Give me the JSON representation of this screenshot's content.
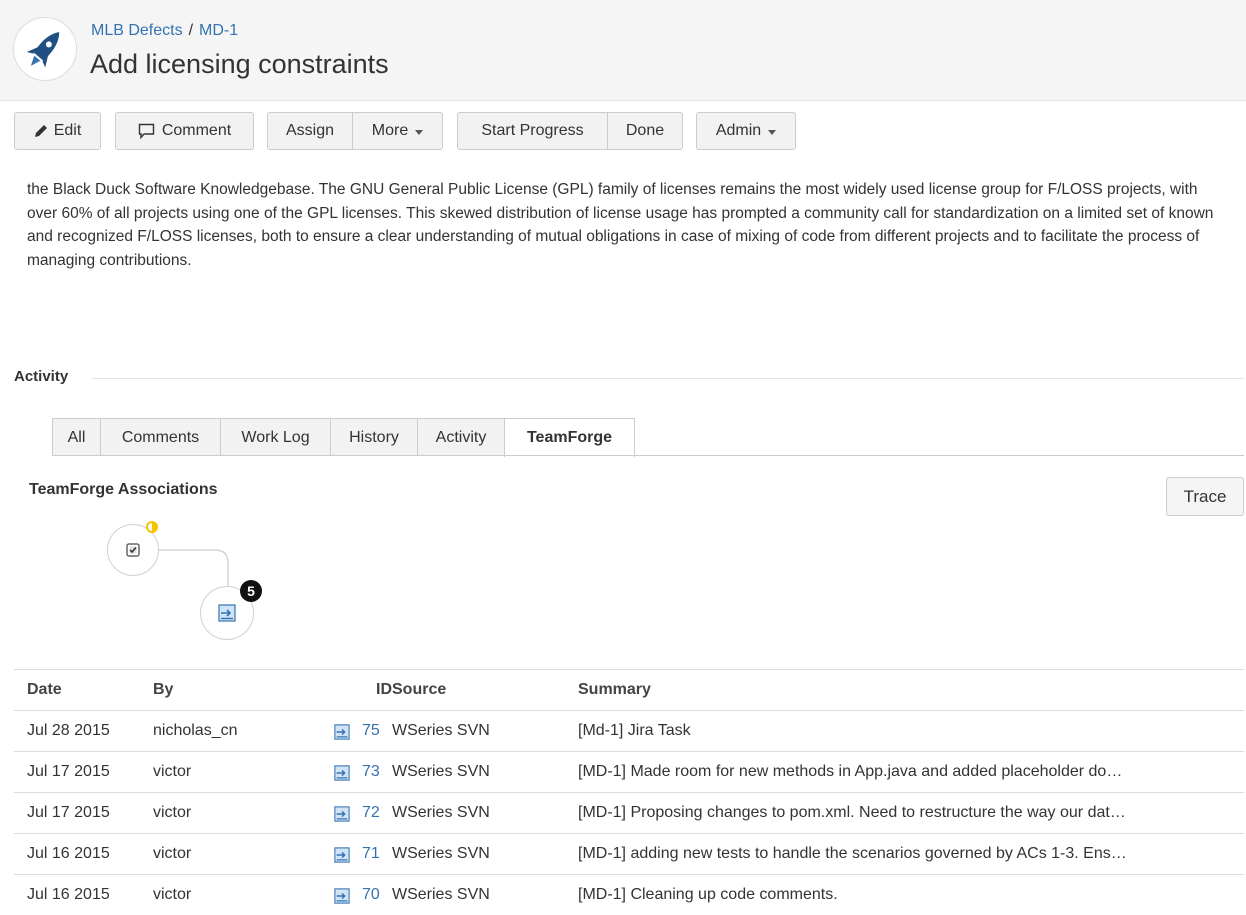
{
  "header": {
    "project": "MLB Defects",
    "separator": "/",
    "issue_key": "MD-1",
    "title": "Add licensing constraints"
  },
  "toolbar": {
    "edit": "Edit",
    "comment": "Comment",
    "assign": "Assign",
    "more": "More",
    "start_progress": "Start Progress",
    "done": "Done",
    "admin": "Admin"
  },
  "description": "the Black Duck Software Knowledgebase. The GNU General Public License (GPL) family of licenses remains the most widely used license group for F/LOSS projects, with over 60% of all projects using one of the GPL licenses. This skewed distribution of license usage has prompted a community call for standardization on a limited set of known and recognized F/LOSS licenses, both to ensure a clear understanding of mutual obligations in case of mixing of code from different projects and to facilitate the process of managing contributions.",
  "activity": {
    "heading": "Activity",
    "tabs": [
      "All",
      "Comments",
      "Work Log",
      "History",
      "Activity",
      "TeamForge"
    ],
    "active_tab": "TeamForge"
  },
  "teamforge": {
    "title": "TeamForge Associations",
    "trace_button": "Trace",
    "association_count": "5",
    "accent_color": "#f5c400",
    "link_color": "#3572b0"
  },
  "table": {
    "headers": {
      "date": "Date",
      "by": "By",
      "id": "ID",
      "source": "Source",
      "summary": "Summary"
    },
    "rows": [
      {
        "date": "Jul 28 2015",
        "by": "nicholas_cn",
        "id": "75",
        "source": "WSeries SVN",
        "summary": "[Md-1] Jira Task",
        "icon": "commit-icon"
      },
      {
        "date": "Jul 17 2015",
        "by": "victor",
        "id": "73",
        "source": "WSeries SVN",
        "summary": "[MD-1] Made room for new methods in App.java and added placeholder do…",
        "icon": "commit-icon"
      },
      {
        "date": "Jul 17 2015",
        "by": "victor",
        "id": "72",
        "source": "WSeries SVN",
        "summary": "[MD-1] Proposing changes to pom.xml. Need to restructure the way our dat…",
        "icon": "commit-icon"
      },
      {
        "date": "Jul 16 2015",
        "by": "victor",
        "id": "71",
        "source": "WSeries SVN",
        "summary": "[MD-1] adding new tests to handle the scenarios governed by ACs 1-3. Ens…",
        "icon": "commit-icon"
      },
      {
        "date": "Jul 16 2015",
        "by": "victor",
        "id": "70",
        "source": "WSeries SVN",
        "summary": "[MD-1] Cleaning up code comments.",
        "icon": "commit-icon"
      }
    ]
  }
}
